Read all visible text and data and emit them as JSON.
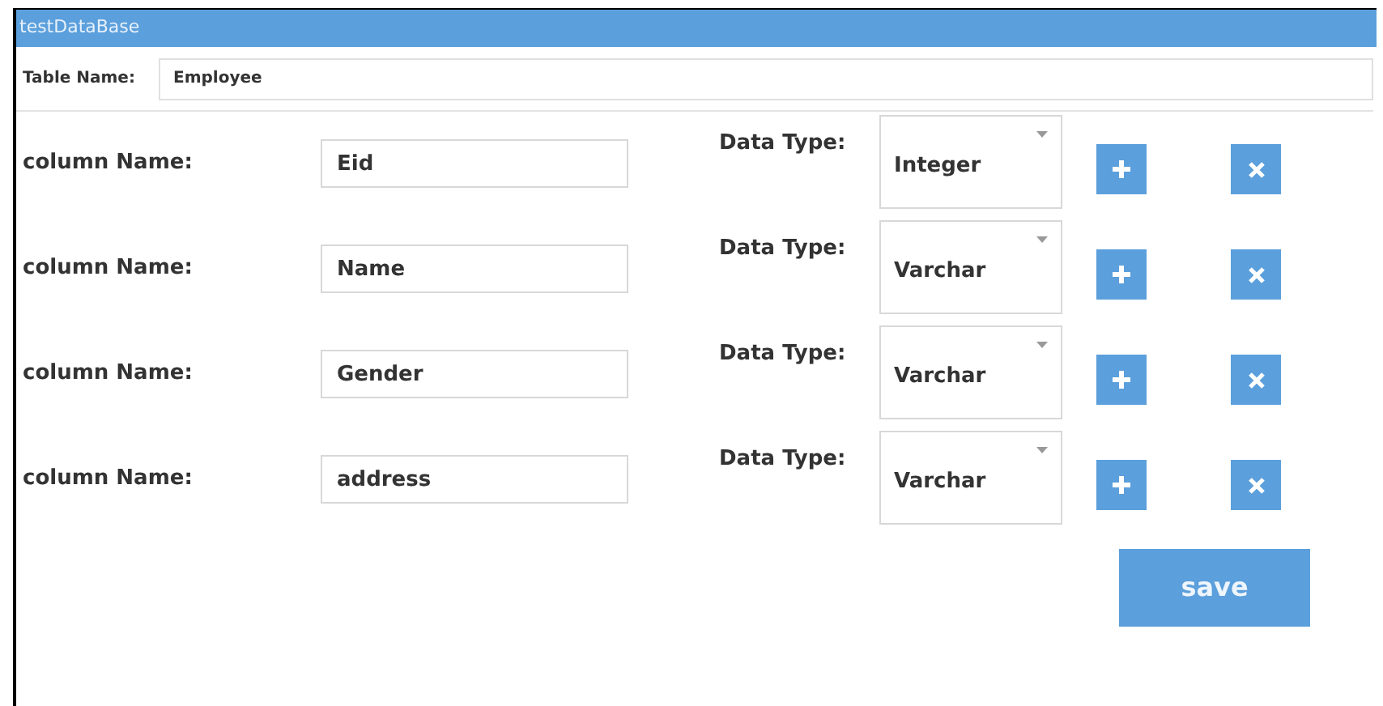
{
  "window": {
    "title": "testDataBase"
  },
  "table_name": {
    "label": "Table Name:",
    "value": "Employee"
  },
  "columns": [
    {
      "label": "column Name:",
      "value": "Eid",
      "type_label": "Data Type:",
      "type": "Integer"
    },
    {
      "label": "column Name:",
      "value": "Name",
      "type_label": "Data Type:",
      "type": "Varchar"
    },
    {
      "label": "column Name:",
      "value": "Gender",
      "type_label": "Data Type:",
      "type": "Varchar"
    },
    {
      "label": "column Name:",
      "value": "address",
      "type_label": "Data Type:",
      "type": "Varchar"
    }
  ],
  "save_button": "save"
}
